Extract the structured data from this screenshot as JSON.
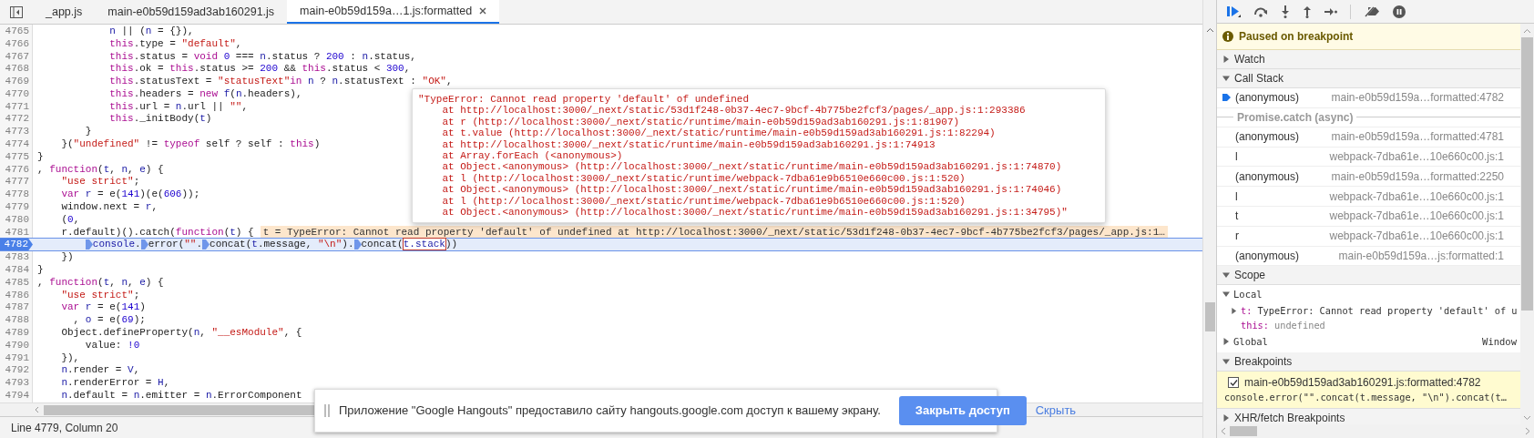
{
  "tabs": [
    {
      "label": "_app.js",
      "selected": false,
      "closable": false
    },
    {
      "label": "main-e0b59d159ad3ab160291.js",
      "selected": false,
      "closable": false
    },
    {
      "label": "main-e0b59d159a…1.js:formatted",
      "selected": true,
      "closable": true
    }
  ],
  "code_lines": [
    {
      "number": "4765",
      "current": false,
      "code": [
        {
          "kind": "v",
          "text": "            n"
        },
        {
          "kind": "p",
          "text": " || ("
        },
        {
          "kind": "v",
          "text": "n"
        },
        {
          "kind": "p",
          "text": " = {}),"
        }
      ]
    },
    {
      "number": "4766",
      "current": false,
      "code": [
        {
          "kind": "k",
          "text": "            this"
        },
        {
          "kind": "p",
          "text": ".type = "
        },
        {
          "kind": "s",
          "text": "\"default\""
        },
        {
          "kind": "p",
          "text": ","
        }
      ]
    },
    {
      "number": "4767",
      "current": false,
      "code": [
        {
          "kind": "k",
          "text": "            this"
        },
        {
          "kind": "p",
          "text": ".status = "
        },
        {
          "kind": "k",
          "text": "void "
        },
        {
          "kind": "n",
          "text": "0"
        },
        {
          "kind": "p",
          "text": " === "
        },
        {
          "kind": "v",
          "text": "n"
        },
        {
          "kind": "p",
          "text": ".status ? "
        },
        {
          "kind": "n",
          "text": "200"
        },
        {
          "kind": "p",
          "text": " : "
        },
        {
          "kind": "v",
          "text": "n"
        },
        {
          "kind": "p",
          "text": ".status,"
        }
      ]
    },
    {
      "number": "4768",
      "current": false,
      "code": [
        {
          "kind": "k",
          "text": "            this"
        },
        {
          "kind": "p",
          "text": ".ok = "
        },
        {
          "kind": "k",
          "text": "this"
        },
        {
          "kind": "p",
          "text": ".status >= "
        },
        {
          "kind": "n",
          "text": "200"
        },
        {
          "kind": "p",
          "text": " && "
        },
        {
          "kind": "k",
          "text": "this"
        },
        {
          "kind": "p",
          "text": ".status < "
        },
        {
          "kind": "n",
          "text": "300"
        },
        {
          "kind": "p",
          "text": ","
        }
      ]
    },
    {
      "number": "4769",
      "current": false,
      "code": [
        {
          "kind": "k",
          "text": "            this"
        },
        {
          "kind": "p",
          "text": ".statusText = "
        },
        {
          "kind": "s",
          "text": "\"statusText\""
        },
        {
          "kind": "k",
          "text": "in "
        },
        {
          "kind": "v",
          "text": "n"
        },
        {
          "kind": "p",
          "text": " ? "
        },
        {
          "kind": "v",
          "text": "n"
        },
        {
          "kind": "p",
          "text": ".statusText : "
        },
        {
          "kind": "s",
          "text": "\"OK\""
        },
        {
          "kind": "p",
          "text": ","
        }
      ]
    },
    {
      "number": "4770",
      "current": false,
      "code": [
        {
          "kind": "k",
          "text": "            this"
        },
        {
          "kind": "p",
          "text": ".headers = "
        },
        {
          "kind": "k",
          "text": "new "
        },
        {
          "kind": "v",
          "text": "f"
        },
        {
          "kind": "p",
          "text": "("
        },
        {
          "kind": "v",
          "text": "n"
        },
        {
          "kind": "p",
          "text": ".headers),"
        }
      ]
    },
    {
      "number": "4771",
      "current": false,
      "code": [
        {
          "kind": "k",
          "text": "            this"
        },
        {
          "kind": "p",
          "text": ".url = "
        },
        {
          "kind": "v",
          "text": "n"
        },
        {
          "kind": "p",
          "text": ".url || "
        },
        {
          "kind": "s",
          "text": "\"\""
        },
        {
          "kind": "p",
          "text": ","
        }
      ]
    },
    {
      "number": "4772",
      "current": false,
      "code": [
        {
          "kind": "k",
          "text": "            this"
        },
        {
          "kind": "p",
          "text": "._initBody("
        },
        {
          "kind": "v",
          "text": "t"
        },
        {
          "kind": "p",
          "text": ")"
        }
      ]
    },
    {
      "number": "4773",
      "current": false,
      "code": [
        {
          "kind": "p",
          "text": "        }"
        }
      ]
    },
    {
      "number": "4774",
      "current": false,
      "code": [
        {
          "kind": "p",
          "text": "    }("
        },
        {
          "kind": "s",
          "text": "\"undefined\""
        },
        {
          "kind": "p",
          "text": " != "
        },
        {
          "kind": "k",
          "text": "typeof"
        },
        {
          "kind": "p",
          "text": " self ? self : "
        },
        {
          "kind": "k",
          "text": "this"
        },
        {
          "kind": "p",
          "text": ")"
        }
      ]
    },
    {
      "number": "4775",
      "current": false,
      "code": [
        {
          "kind": "p",
          "text": "}"
        }
      ]
    },
    {
      "number": "4776",
      "current": false,
      "code": [
        {
          "kind": "p",
          "text": ", "
        },
        {
          "kind": "k",
          "text": "function"
        },
        {
          "kind": "p",
          "text": "("
        },
        {
          "kind": "v",
          "text": "t"
        },
        {
          "kind": "p",
          "text": ", "
        },
        {
          "kind": "v",
          "text": "n"
        },
        {
          "kind": "p",
          "text": ", "
        },
        {
          "kind": "v",
          "text": "e"
        },
        {
          "kind": "p",
          "text": ") {"
        }
      ]
    },
    {
      "number": "4777",
      "current": false,
      "code": [
        {
          "kind": "s",
          "text": "    \"use strict\""
        },
        {
          "kind": "p",
          "text": ";"
        }
      ]
    },
    {
      "number": "4778",
      "current": false,
      "code": [
        {
          "kind": "k",
          "text": "    var "
        },
        {
          "kind": "v",
          "text": "r"
        },
        {
          "kind": "p",
          "text": " = e("
        },
        {
          "kind": "n",
          "text": "141"
        },
        {
          "kind": "p",
          "text": ")(e("
        },
        {
          "kind": "n",
          "text": "606"
        },
        {
          "kind": "p",
          "text": "));"
        }
      ]
    },
    {
      "number": "4779",
      "current": false,
      "code": [
        {
          "kind": "p",
          "text": "    window.next = "
        },
        {
          "kind": "v",
          "text": "r"
        },
        {
          "kind": "p",
          "text": ","
        }
      ]
    },
    {
      "number": "4780",
      "current": false,
      "code": [
        {
          "kind": "p",
          "text": "    ("
        },
        {
          "kind": "n",
          "text": "0"
        },
        {
          "kind": "p",
          "text": ","
        }
      ]
    },
    {
      "number": "4781",
      "current": false,
      "code": [
        {
          "kind": "p",
          "text": "    r.default)().catch("
        },
        {
          "kind": "k",
          "text": "function"
        },
        {
          "kind": "p",
          "text": "("
        },
        {
          "kind": "v",
          "text": "t"
        },
        {
          "kind": "p",
          "text": ") {"
        }
      ],
      "inline_value": "t = TypeError: Cannot read property 'default' of undefined at http://localhost:3000/_next/static/53d1f248-0b37-4ec7-9bcf-4b775be2fcf3/pages/_app.js:1…"
    },
    {
      "number": "4782",
      "current": true,
      "code": [
        {
          "kind": "x"
        },
        {
          "kind": "v",
          "text": "        console"
        },
        {
          "kind": "p",
          "text": "."
        },
        {
          "kind": "x"
        },
        {
          "kind": "p",
          "text": "error("
        },
        {
          "kind": "s",
          "text": "\"\""
        },
        {
          "kind": "p",
          "text": "."
        },
        {
          "kind": "x"
        },
        {
          "kind": "p",
          "text": "concat("
        },
        {
          "kind": "v",
          "text": "t"
        },
        {
          "kind": "p",
          "text": ".message, "
        },
        {
          "kind": "s",
          "text": "\"\\n\""
        },
        {
          "kind": "p",
          "text": ")."
        },
        {
          "kind": "x"
        },
        {
          "kind": "p",
          "text": "concat("
        },
        {
          "kind": "h",
          "text": "t.stack"
        },
        {
          "kind": "p",
          "text": "))"
        }
      ]
    },
    {
      "number": "4783",
      "current": false,
      "code": [
        {
          "kind": "p",
          "text": "    })"
        }
      ]
    },
    {
      "number": "4784",
      "current": false,
      "code": [
        {
          "kind": "p",
          "text": "}"
        }
      ]
    },
    {
      "number": "4785",
      "current": false,
      "code": [
        {
          "kind": "p",
          "text": ", "
        },
        {
          "kind": "k",
          "text": "function"
        },
        {
          "kind": "p",
          "text": "("
        },
        {
          "kind": "v",
          "text": "t"
        },
        {
          "kind": "p",
          "text": ", "
        },
        {
          "kind": "v",
          "text": "n"
        },
        {
          "kind": "p",
          "text": ", "
        },
        {
          "kind": "v",
          "text": "e"
        },
        {
          "kind": "p",
          "text": ") {"
        }
      ]
    },
    {
      "number": "4786",
      "current": false,
      "code": [
        {
          "kind": "s",
          "text": "    \"use strict\""
        },
        {
          "kind": "p",
          "text": ";"
        }
      ]
    },
    {
      "number": "4787",
      "current": false,
      "code": [
        {
          "kind": "k",
          "text": "    var "
        },
        {
          "kind": "v",
          "text": "r"
        },
        {
          "kind": "p",
          "text": " = e("
        },
        {
          "kind": "n",
          "text": "141"
        },
        {
          "kind": "p",
          "text": ")"
        }
      ]
    },
    {
      "number": "4788",
      "current": false,
      "code": [
        {
          "kind": "p",
          "text": "      , "
        },
        {
          "kind": "v",
          "text": "o"
        },
        {
          "kind": "p",
          "text": " = e("
        },
        {
          "kind": "n",
          "text": "69"
        },
        {
          "kind": "p",
          "text": ");"
        }
      ]
    },
    {
      "number": "4789",
      "current": false,
      "code": [
        {
          "kind": "p",
          "text": "    Object.defineProperty("
        },
        {
          "kind": "v",
          "text": "n"
        },
        {
          "kind": "p",
          "text": ", "
        },
        {
          "kind": "s",
          "text": "\"__esModule\""
        },
        {
          "kind": "p",
          "text": ", {"
        }
      ]
    },
    {
      "number": "4790",
      "current": false,
      "code": [
        {
          "kind": "p",
          "text": "        value: "
        },
        {
          "kind": "n",
          "text": "!0"
        }
      ]
    },
    {
      "number": "4791",
      "current": false,
      "code": [
        {
          "kind": "p",
          "text": "    }),"
        }
      ]
    },
    {
      "number": "4792",
      "current": false,
      "code": [
        {
          "kind": "v",
          "text": "    n"
        },
        {
          "kind": "p",
          "text": ".render = "
        },
        {
          "kind": "v",
          "text": "V"
        },
        {
          "kind": "p",
          "text": ","
        }
      ]
    },
    {
      "number": "4793",
      "current": false,
      "code": [
        {
          "kind": "v",
          "text": "    n"
        },
        {
          "kind": "p",
          "text": ".renderError = "
        },
        {
          "kind": "v",
          "text": "H"
        },
        {
          "kind": "p",
          "text": ","
        }
      ]
    },
    {
      "number": "4794",
      "current": false,
      "code": [
        {
          "kind": "v",
          "text": "    n"
        },
        {
          "kind": "p",
          "text": ".default = "
        },
        {
          "kind": "v",
          "text": "n"
        },
        {
          "kind": "p",
          "text": ".emitter = "
        },
        {
          "kind": "v",
          "text": "n"
        },
        {
          "kind": "p",
          "text": ".ErrorComponent"
        }
      ]
    }
  ],
  "value_tooltip": [
    "\"TypeError: Cannot read property 'default' of undefined",
    "    at http://localhost:3000/_next/static/53d1f248-0b37-4ec7-9bcf-4b775be2fcf3/pages/_app.js:1:293386",
    "    at r (http://localhost:3000/_next/static/runtime/main-e0b59d159ad3ab160291.js:1:81907)",
    "    at t.value (http://localhost:3000/_next/static/runtime/main-e0b59d159ad3ab160291.js:1:82294)",
    "    at http://localhost:3000/_next/static/runtime/main-e0b59d159ad3ab160291.js:1:74913",
    "    at Array.forEach (<anonymous>)",
    "    at Object.<anonymous> (http://localhost:3000/_next/static/runtime/main-e0b59d159ad3ab160291.js:1:74870)",
    "    at l (http://localhost:3000/_next/static/runtime/webpack-7dba61e9b6510e660c00.js:1:520)",
    "    at Object.<anonymous> (http://localhost:3000/_next/static/runtime/main-e0b59d159ad3ab160291.js:1:74046)",
    "    at l (http://localhost:3000/_next/static/runtime/webpack-7dba61e9b6510e660c00.js:1:520)",
    "    at Object.<anonymous> (http://localhost:3000/_next/static/runtime/main-e0b59d159ad3ab160291.js:1:34795)\""
  ],
  "status_bar": "Line 4779, Column 20",
  "debugger": {
    "paused_banner": "Paused on breakpoint",
    "watch": {
      "title": "Watch",
      "expanded": false
    },
    "call_stack": {
      "title": "Call Stack",
      "expanded": true,
      "frames": [
        {
          "kind": "frame",
          "name": "(anonymous)",
          "location": "main-e0b59d159a…formatted:4782",
          "selected": true
        },
        {
          "kind": "async",
          "name": "Promise.catch (async)"
        },
        {
          "kind": "frame",
          "name": "(anonymous)",
          "location": "main-e0b59d159a…formatted:4781",
          "selected": false
        },
        {
          "kind": "frame",
          "name": "l",
          "location": "webpack-7dba61e…10e660c00.js:1",
          "selected": false
        },
        {
          "kind": "frame",
          "name": "(anonymous)",
          "location": "main-e0b59d159a…formatted:2250",
          "selected": false
        },
        {
          "kind": "frame",
          "name": "l",
          "location": "webpack-7dba61e…10e660c00.js:1",
          "selected": false
        },
        {
          "kind": "frame",
          "name": "t",
          "location": "webpack-7dba61e…10e660c00.js:1",
          "selected": false
        },
        {
          "kind": "frame",
          "name": "r",
          "location": "webpack-7dba61e…10e660c00.js:1",
          "selected": false
        },
        {
          "kind": "frame",
          "name": "(anonymous)",
          "location": "main-e0b59d159a…js:formatted:1",
          "selected": false
        }
      ]
    },
    "scope": {
      "title": "Scope",
      "expanded": true,
      "scopes": [
        {
          "name": "Local",
          "expanded": true,
          "variables": [
            {
              "name": "t:",
              "value": "TypeError: Cannot read property 'default' of u",
              "expandable": true
            },
            {
              "name": "this:",
              "value": "undefined",
              "expandable": false
            }
          ]
        },
        {
          "name": "Global",
          "expanded": false,
          "value": "Window"
        }
      ]
    },
    "breakpoints": {
      "title": "Breakpoints",
      "expanded": true,
      "items": [
        {
          "file": "main-e0b59d159ad3ab160291.js:formatted:4782",
          "code": "console.error(\"\".concat(t.message, \"\\n\").concat(t…",
          "checked": true
        }
      ]
    },
    "xhr_breakpoints": {
      "title": "XHR/fetch Breakpoints",
      "expanded": false
    }
  },
  "notification": {
    "message": "Приложение \"Google Hangouts\" предоставило сайту hangouts.google.com доступ к вашему экрану.",
    "primary_button": "Закрыть доступ",
    "link": "Скрыть"
  }
}
